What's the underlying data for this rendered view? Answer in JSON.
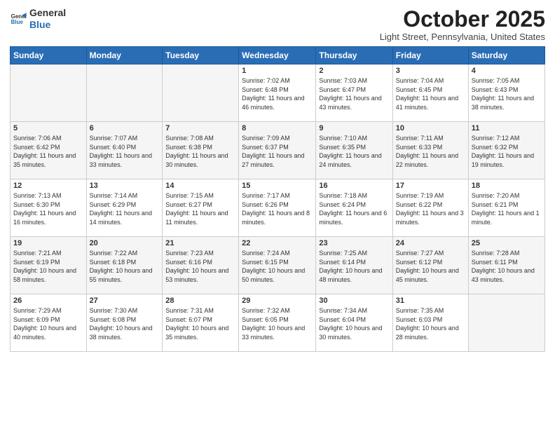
{
  "header": {
    "logo_general": "General",
    "logo_blue": "Blue",
    "month_title": "October 2025",
    "location": "Light Street, Pennsylvania, United States"
  },
  "days_of_week": [
    "Sunday",
    "Monday",
    "Tuesday",
    "Wednesday",
    "Thursday",
    "Friday",
    "Saturday"
  ],
  "weeks": [
    [
      {
        "num": "",
        "info": ""
      },
      {
        "num": "",
        "info": ""
      },
      {
        "num": "",
        "info": ""
      },
      {
        "num": "1",
        "info": "Sunrise: 7:02 AM\nSunset: 6:48 PM\nDaylight: 11 hours and 46 minutes."
      },
      {
        "num": "2",
        "info": "Sunrise: 7:03 AM\nSunset: 6:47 PM\nDaylight: 11 hours and 43 minutes."
      },
      {
        "num": "3",
        "info": "Sunrise: 7:04 AM\nSunset: 6:45 PM\nDaylight: 11 hours and 41 minutes."
      },
      {
        "num": "4",
        "info": "Sunrise: 7:05 AM\nSunset: 6:43 PM\nDaylight: 11 hours and 38 minutes."
      }
    ],
    [
      {
        "num": "5",
        "info": "Sunrise: 7:06 AM\nSunset: 6:42 PM\nDaylight: 11 hours and 35 minutes."
      },
      {
        "num": "6",
        "info": "Sunrise: 7:07 AM\nSunset: 6:40 PM\nDaylight: 11 hours and 33 minutes."
      },
      {
        "num": "7",
        "info": "Sunrise: 7:08 AM\nSunset: 6:38 PM\nDaylight: 11 hours and 30 minutes."
      },
      {
        "num": "8",
        "info": "Sunrise: 7:09 AM\nSunset: 6:37 PM\nDaylight: 11 hours and 27 minutes."
      },
      {
        "num": "9",
        "info": "Sunrise: 7:10 AM\nSunset: 6:35 PM\nDaylight: 11 hours and 24 minutes."
      },
      {
        "num": "10",
        "info": "Sunrise: 7:11 AM\nSunset: 6:33 PM\nDaylight: 11 hours and 22 minutes."
      },
      {
        "num": "11",
        "info": "Sunrise: 7:12 AM\nSunset: 6:32 PM\nDaylight: 11 hours and 19 minutes."
      }
    ],
    [
      {
        "num": "12",
        "info": "Sunrise: 7:13 AM\nSunset: 6:30 PM\nDaylight: 11 hours and 16 minutes."
      },
      {
        "num": "13",
        "info": "Sunrise: 7:14 AM\nSunset: 6:29 PM\nDaylight: 11 hours and 14 minutes."
      },
      {
        "num": "14",
        "info": "Sunrise: 7:15 AM\nSunset: 6:27 PM\nDaylight: 11 hours and 11 minutes."
      },
      {
        "num": "15",
        "info": "Sunrise: 7:17 AM\nSunset: 6:26 PM\nDaylight: 11 hours and 8 minutes."
      },
      {
        "num": "16",
        "info": "Sunrise: 7:18 AM\nSunset: 6:24 PM\nDaylight: 11 hours and 6 minutes."
      },
      {
        "num": "17",
        "info": "Sunrise: 7:19 AM\nSunset: 6:22 PM\nDaylight: 11 hours and 3 minutes."
      },
      {
        "num": "18",
        "info": "Sunrise: 7:20 AM\nSunset: 6:21 PM\nDaylight: 11 hours and 1 minute."
      }
    ],
    [
      {
        "num": "19",
        "info": "Sunrise: 7:21 AM\nSunset: 6:19 PM\nDaylight: 10 hours and 58 minutes."
      },
      {
        "num": "20",
        "info": "Sunrise: 7:22 AM\nSunset: 6:18 PM\nDaylight: 10 hours and 55 minutes."
      },
      {
        "num": "21",
        "info": "Sunrise: 7:23 AM\nSunset: 6:16 PM\nDaylight: 10 hours and 53 minutes."
      },
      {
        "num": "22",
        "info": "Sunrise: 7:24 AM\nSunset: 6:15 PM\nDaylight: 10 hours and 50 minutes."
      },
      {
        "num": "23",
        "info": "Sunrise: 7:25 AM\nSunset: 6:14 PM\nDaylight: 10 hours and 48 minutes."
      },
      {
        "num": "24",
        "info": "Sunrise: 7:27 AM\nSunset: 6:12 PM\nDaylight: 10 hours and 45 minutes."
      },
      {
        "num": "25",
        "info": "Sunrise: 7:28 AM\nSunset: 6:11 PM\nDaylight: 10 hours and 43 minutes."
      }
    ],
    [
      {
        "num": "26",
        "info": "Sunrise: 7:29 AM\nSunset: 6:09 PM\nDaylight: 10 hours and 40 minutes."
      },
      {
        "num": "27",
        "info": "Sunrise: 7:30 AM\nSunset: 6:08 PM\nDaylight: 10 hours and 38 minutes."
      },
      {
        "num": "28",
        "info": "Sunrise: 7:31 AM\nSunset: 6:07 PM\nDaylight: 10 hours and 35 minutes."
      },
      {
        "num": "29",
        "info": "Sunrise: 7:32 AM\nSunset: 6:05 PM\nDaylight: 10 hours and 33 minutes."
      },
      {
        "num": "30",
        "info": "Sunrise: 7:34 AM\nSunset: 6:04 PM\nDaylight: 10 hours and 30 minutes."
      },
      {
        "num": "31",
        "info": "Sunrise: 7:35 AM\nSunset: 6:03 PM\nDaylight: 10 hours and 28 minutes."
      },
      {
        "num": "",
        "info": ""
      }
    ]
  ]
}
